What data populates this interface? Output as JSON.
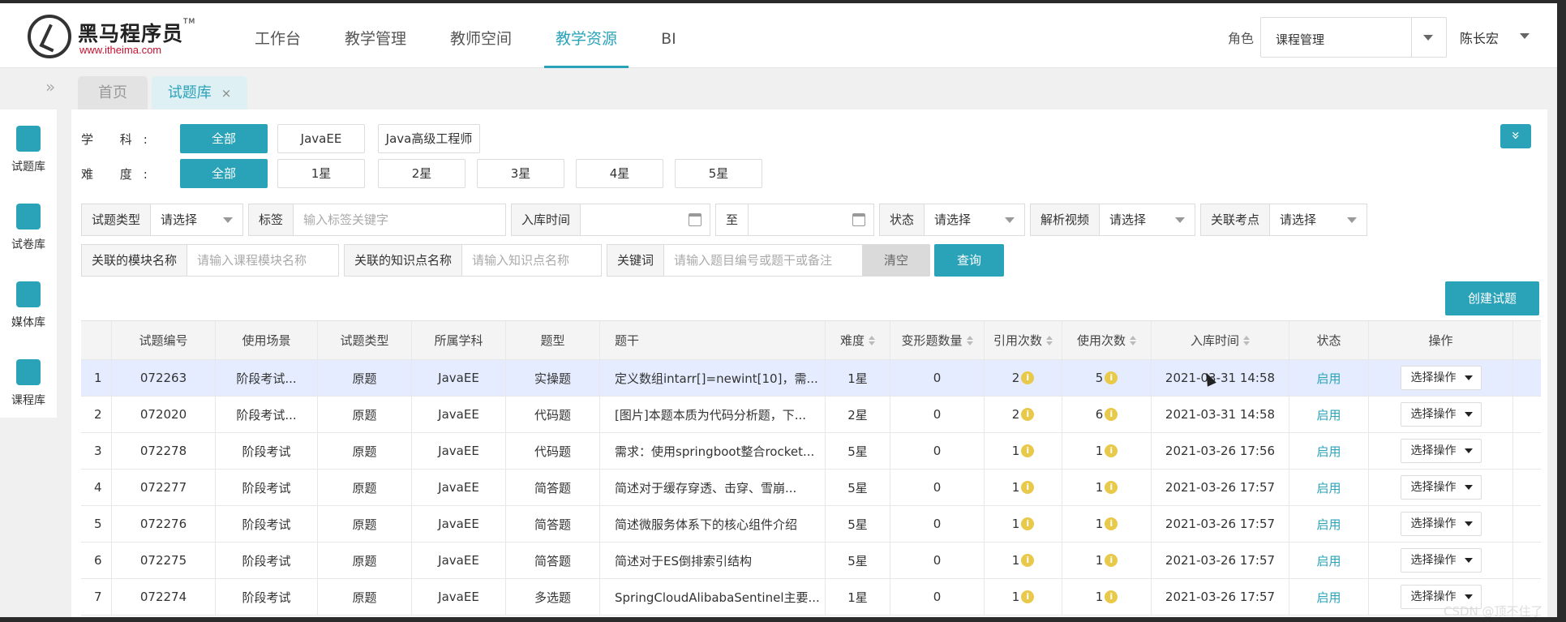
{
  "header": {
    "logo_text": "黑马程序员",
    "logo_tm": "TM",
    "logo_url": "www.itheima.com",
    "nav": [
      "工作台",
      "教学管理",
      "教师空间",
      "教学资源",
      "BI"
    ],
    "role_label": "角色",
    "role_value": "课程管理",
    "user_name": "陈长宏"
  },
  "tabs": {
    "collapse": "»",
    "home": "首页",
    "bank": "试题库",
    "close": "×"
  },
  "sidebar": [
    "试题库",
    "试卷库",
    "媒体库",
    "课程库"
  ],
  "filters": {
    "subject_label": "学 科:",
    "subjects": [
      "全部",
      "JavaEE",
      "Java高级工程师"
    ],
    "difficulty_label": "难 度:",
    "difficulties": [
      "全部",
      "1星",
      "2星",
      "3星",
      "4星",
      "5星"
    ],
    "expand_icon": "»"
  },
  "search": {
    "type_label": "试题类型",
    "type_value": "请选择",
    "tag_label": "标签",
    "tag_placeholder": "输入标签关键字",
    "date_label": "入库时间",
    "date_to": "至",
    "state_label": "状态",
    "state_value": "请选择",
    "video_label": "解析视频",
    "video_value": "请选择",
    "point_label": "关联考点",
    "point_value": "请选择",
    "module_label": "关联的模块名称",
    "module_placeholder": "请输入课程模块名称",
    "knowledge_label": "关联的知识点名称",
    "knowledge_placeholder": "请输入知识点名称",
    "keyword_label": "关键词",
    "keyword_placeholder": "请输入题目编号或题干或备注",
    "clear": "清空",
    "query": "查询",
    "create": "创建试题"
  },
  "table": {
    "headers": [
      "试题编号",
      "使用场景",
      "试题类型",
      "所属学科",
      "题型",
      "题干",
      "难度",
      "变形题数量",
      "引用次数",
      "使用次数",
      "入库时间",
      "状态",
      "操作"
    ],
    "rows": [
      {
        "idx": "1",
        "id": "072263",
        "scene": "阶段考试...",
        "type": "原题",
        "subject": "JavaEE",
        "kind": "实操题",
        "stem": "定义数组intarr[]=newint[10]，需...",
        "level": "1星",
        "variants": "0",
        "refs": "2",
        "uses": "5",
        "date": "2021-03-31 14:58",
        "status": "启用",
        "op": "选择操作"
      },
      {
        "idx": "2",
        "id": "072020",
        "scene": "阶段考试...",
        "type": "原题",
        "subject": "JavaEE",
        "kind": "代码题",
        "stem": "[图片]本题本质为代码分析题，下...",
        "level": "2星",
        "variants": "0",
        "refs": "2",
        "uses": "6",
        "date": "2021-03-31 14:58",
        "status": "启用",
        "op": "选择操作"
      },
      {
        "idx": "3",
        "id": "072278",
        "scene": "阶段考试",
        "type": "原题",
        "subject": "JavaEE",
        "kind": "代码题",
        "stem": "需求：使用springboot整合rocket...",
        "level": "5星",
        "variants": "0",
        "refs": "1",
        "uses": "1",
        "date": "2021-03-26 17:56",
        "status": "启用",
        "op": "选择操作"
      },
      {
        "idx": "4",
        "id": "072277",
        "scene": "阶段考试",
        "type": "原题",
        "subject": "JavaEE",
        "kind": "简答题",
        "stem": "简述对于缓存穿透、击穿、雪崩...",
        "level": "5星",
        "variants": "0",
        "refs": "1",
        "uses": "1",
        "date": "2021-03-26 17:57",
        "status": "启用",
        "op": "选择操作"
      },
      {
        "idx": "5",
        "id": "072276",
        "scene": "阶段考试",
        "type": "原题",
        "subject": "JavaEE",
        "kind": "简答题",
        "stem": "简述微服务体系下的核心组件介绍",
        "level": "5星",
        "variants": "0",
        "refs": "1",
        "uses": "1",
        "date": "2021-03-26 17:57",
        "status": "启用",
        "op": "选择操作"
      },
      {
        "idx": "6",
        "id": "072275",
        "scene": "阶段考试",
        "type": "原题",
        "subject": "JavaEE",
        "kind": "简答题",
        "stem": "简述对于ES倒排索引结构",
        "level": "5星",
        "variants": "0",
        "refs": "1",
        "uses": "1",
        "date": "2021-03-26 17:57",
        "status": "启用",
        "op": "选择操作"
      },
      {
        "idx": "7",
        "id": "072274",
        "scene": "阶段考试",
        "type": "原题",
        "subject": "JavaEE",
        "kind": "多选题",
        "stem": "SpringCloudAlibabaSentinel主要...",
        "level": "1星",
        "variants": "0",
        "refs": "1",
        "uses": "1",
        "date": "2021-03-26 17:57",
        "status": "启用",
        "op": "选择操作"
      }
    ]
  },
  "watermark": "CSDN @顶不住了",
  "colors": {
    "accent": "#2aa3b8",
    "highlight_row": "#e5ecff",
    "info": "#e8c94a"
  }
}
